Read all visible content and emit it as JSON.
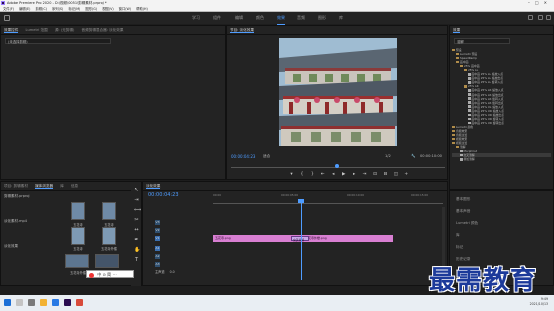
{
  "app": {
    "title": "Adobe Premiere Pro 2020 - D:\\视频\\0051\\剪辑素材.prproj *"
  },
  "menu": [
    "文件(F)",
    "编辑(E)",
    "剪辑(C)",
    "序列(S)",
    "标记(M)",
    "图形(G)",
    "视图(V)",
    "窗口(W)",
    "帮助(H)"
  ],
  "workspaces": [
    {
      "label": "学习",
      "active": false
    },
    {
      "label": "组件",
      "active": false
    },
    {
      "label": "编辑",
      "active": false
    },
    {
      "label": "颜色",
      "active": false
    },
    {
      "label": "效果",
      "active": true
    },
    {
      "label": "音频",
      "active": false
    },
    {
      "label": "图形",
      "active": false
    },
    {
      "label": "库",
      "active": false
    }
  ],
  "source_panel": {
    "tabs": [
      "效果控件",
      "Lumetri 范围",
      "源: (无剪辑)",
      "音频剪辑混合器: 淡化效果"
    ],
    "placeholder": "(未选择剪辑)"
  },
  "program_panel": {
    "tab": "节目: 淡化效果",
    "timecode": "00:00:04:23",
    "fit": "适合",
    "quality": "1/2",
    "duration": "00:00:10:00"
  },
  "effects_panel": {
    "tab": "效果",
    "search": "溶解",
    "tree": [
      {
        "label": "预设",
        "type": "folder",
        "indent": 0
      },
      {
        "label": "Lumetri 预设",
        "type": "folder",
        "indent": 1
      },
      {
        "label": "SpeedRamp",
        "type": "folder",
        "indent": 1
      },
      {
        "label": "画中画",
        "type": "folder",
        "indent": 1
      },
      {
        "label": "25% 画中画",
        "type": "folder",
        "indent": 2
      },
      {
        "label": "25% LL",
        "type": "folder",
        "indent": 3
      },
      {
        "label": "画中画 25% LL 缩放入点",
        "type": "file",
        "indent": 4
      },
      {
        "label": "画中画 25% LL 缩放出点",
        "type": "file",
        "indent": 4
      },
      {
        "label": "画中画 25% LL 旋转入点",
        "type": "file",
        "indent": 4
      },
      {
        "label": "25% LR",
        "type": "folder",
        "indent": 3
      },
      {
        "label": "画中画 25% LR 缩放入点",
        "type": "file",
        "indent": 4
      },
      {
        "label": "画中画 25% LR 缩放出点",
        "type": "file",
        "indent": 4
      },
      {
        "label": "画中画 25% LR 旋转入点",
        "type": "file",
        "indent": 4
      },
      {
        "label": "画中画 25% LR 旋转出点",
        "type": "file",
        "indent": 4
      },
      {
        "label": "画中画 25% UL 缩放入点",
        "type": "file",
        "indent": 4
      },
      {
        "label": "画中画 25% UR 缩放入点",
        "type": "file",
        "indent": 4
      },
      {
        "label": "画中画 25% UR 缩放出点",
        "type": "file",
        "indent": 4
      },
      {
        "label": "画中画 25% UR 旋转入点",
        "type": "file",
        "indent": 4
      },
      {
        "label": "画中画 25% UR 旋转出点",
        "type": "file",
        "indent": 4
      },
      {
        "label": "Lumetri 颜色",
        "type": "folder",
        "indent": 0
      },
      {
        "label": "音频效果",
        "type": "folder",
        "indent": 0
      },
      {
        "label": "音频过渡",
        "type": "folder",
        "indent": 0
      },
      {
        "label": "视频效果",
        "type": "folder",
        "indent": 0
      },
      {
        "label": "视频过渡",
        "type": "folder",
        "indent": 0
      },
      {
        "label": "溶解",
        "type": "folder",
        "indent": 1
      },
      {
        "label": "MorphCut",
        "type": "file",
        "indent": 2
      },
      {
        "label": "交叉溶解",
        "type": "file",
        "indent": 2,
        "selected": true
      },
      {
        "label": "叠加溶解",
        "type": "file",
        "indent": 2
      }
    ]
  },
  "essentials": [
    "基本图形",
    "基本声音",
    "Lumetri 颜色",
    "库",
    "标记",
    "历史记录",
    "信息"
  ],
  "project_panel": {
    "tabs": [
      "项目: 剪辑素材",
      "媒体浏览器",
      "库",
      "信息"
    ],
    "list": [
      "剪辑素材.prproj",
      "",
      "",
      "",
      "",
      "淡化素材.mp4",
      "",
      "",
      "",
      "",
      "淡化效果"
    ],
    "items": [
      "五花寺",
      "五花寺",
      "五花寺",
      "五花寺外楼",
      "五花寺外楼",
      "淡化效果"
    ]
  },
  "timeline": {
    "tab": "淡化效果",
    "timecode": "00:00:04:23",
    "ruler": [
      "00:00",
      "00:00:05:00",
      "00:00:10:00",
      "00:00:15:00"
    ],
    "tracks": [
      "V3",
      "V2",
      "V1",
      "A1",
      "A2",
      "A3",
      "主声道"
    ],
    "master_value": "0.0",
    "clip1": "五花寺.png",
    "transition": "交叉溶解",
    "clip2": "五花寺外楼.png"
  },
  "taskbar": {
    "time": "9:49",
    "date": "2021/10/13"
  },
  "ime": {
    "text": "中 ⊙ 简 ⋯"
  },
  "watermark": {
    "text": "最需教育"
  }
}
